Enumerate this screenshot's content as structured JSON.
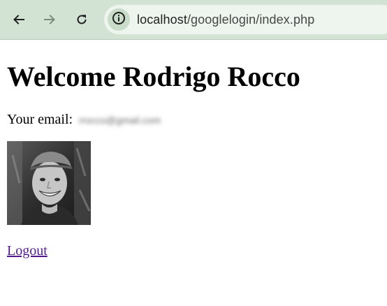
{
  "browser": {
    "url_host": "localhost",
    "url_path": "/googlelogin/index.php"
  },
  "page": {
    "heading": "Welcome Rodrigo Rocco",
    "email_label": "Your email:",
    "email_value": "rrocco@gmail.com",
    "logout_link": "Logout"
  },
  "icons": {
    "back": "arrow-left-icon",
    "forward": "arrow-right-icon",
    "reload": "reload-icon",
    "site_info": "info-circle-icon"
  },
  "colors": {
    "toolbar_bg": "#d3e3d3",
    "omnibox_bg": "#eef4ee",
    "visited_link": "#551a8b"
  }
}
